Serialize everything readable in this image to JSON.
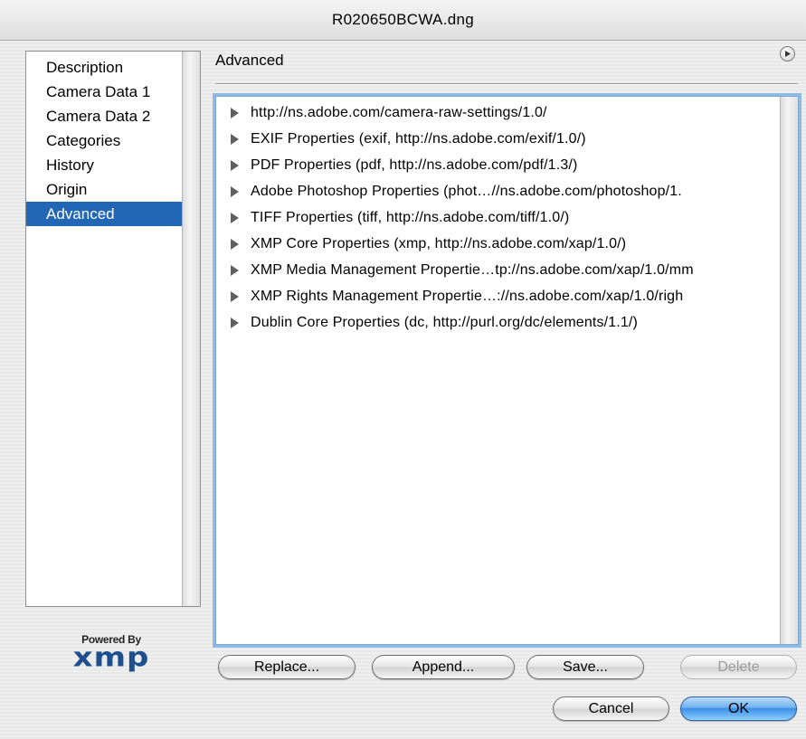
{
  "window": {
    "title": "R020650BCWA.dng"
  },
  "sidebar": {
    "items": [
      {
        "label": "Description"
      },
      {
        "label": "Camera Data 1"
      },
      {
        "label": "Camera Data 2"
      },
      {
        "label": "Categories"
      },
      {
        "label": "History"
      },
      {
        "label": "Origin"
      },
      {
        "label": "Advanced"
      }
    ],
    "selected": "Advanced"
  },
  "logo": {
    "powered_by": "Powered By",
    "wordmark": "xmp"
  },
  "header": {
    "title": "Advanced",
    "menu_icon": "play-circle-icon"
  },
  "tree": {
    "items": [
      {
        "label": "http://ns.adobe.com/camera-raw-settings/1.0/"
      },
      {
        "label": "EXIF Properties (exif, http://ns.adobe.com/exif/1.0/)"
      },
      {
        "label": "PDF Properties (pdf, http://ns.adobe.com/pdf/1.3/)"
      },
      {
        "label": "Adobe Photoshop Properties (phot…//ns.adobe.com/photoshop/1."
      },
      {
        "label": "TIFF Properties (tiff, http://ns.adobe.com/tiff/1.0/)"
      },
      {
        "label": "XMP Core Properties (xmp, http://ns.adobe.com/xap/1.0/)"
      },
      {
        "label": "XMP Media Management Propertie…tp://ns.adobe.com/xap/1.0/mm"
      },
      {
        "label": "XMP Rights Management Propertie…://ns.adobe.com/xap/1.0/righ"
      },
      {
        "label": "Dublin Core Properties (dc, http://purl.org/dc/elements/1.1/)"
      }
    ]
  },
  "buttons": {
    "replace": "Replace...",
    "append": "Append...",
    "save": "Save...",
    "delete": "Delete",
    "cancel": "Cancel",
    "ok": "OK"
  },
  "colors": {
    "selection": "#2266b6",
    "focus_ring": "#8cbbe8",
    "default_button": "#3a8ee6"
  }
}
